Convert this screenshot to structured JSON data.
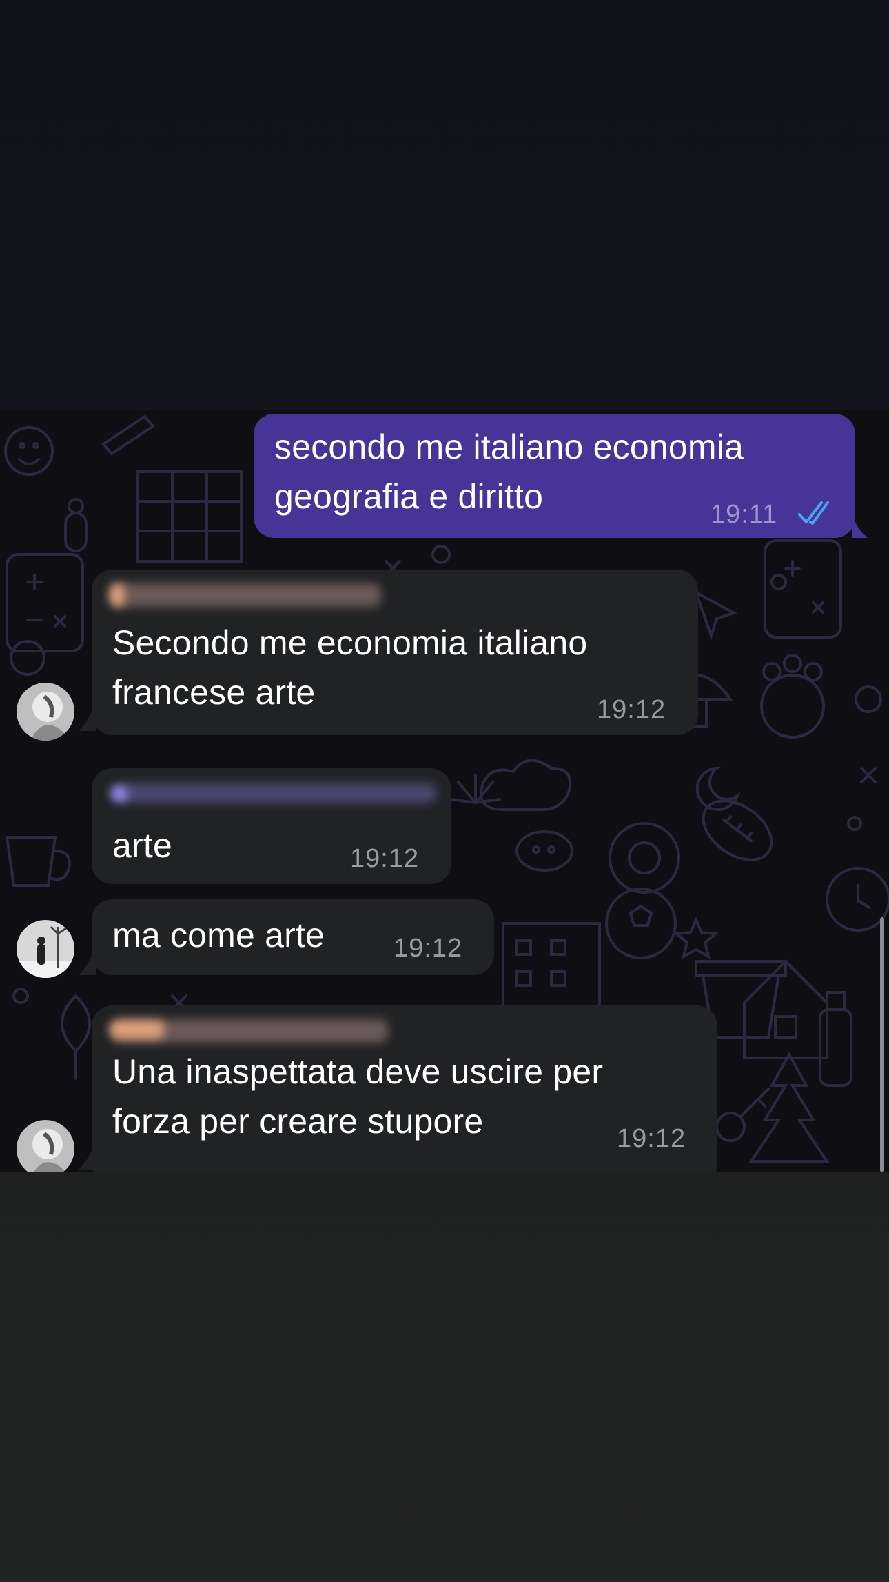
{
  "colors": {
    "outgoing_bubble": "#463497",
    "incoming_bubble": "#212224",
    "read_ticks": "#4aa3f0",
    "chat_background": "#0e0e13"
  },
  "messages": [
    {
      "direction": "outgoing",
      "lines": [
        "secondo me italiano economia",
        "geografia e diritto"
      ],
      "time": "19:11",
      "status": "read-double-check-icon"
    },
    {
      "direction": "incoming",
      "sender": "redacted",
      "lines": [
        "Secondo me economia italiano",
        "francese arte"
      ],
      "time": "19:12"
    },
    {
      "direction": "incoming",
      "sender": "redacted",
      "lines": [
        "arte"
      ],
      "time": "19:12"
    },
    {
      "direction": "incoming",
      "lines": [
        "ma come arte"
      ],
      "time": "19:12"
    },
    {
      "direction": "incoming",
      "sender": "redacted",
      "lines": [
        "Una inaspettata deve uscire per",
        "forza per creare stupore"
      ],
      "time": "19:12"
    }
  ]
}
